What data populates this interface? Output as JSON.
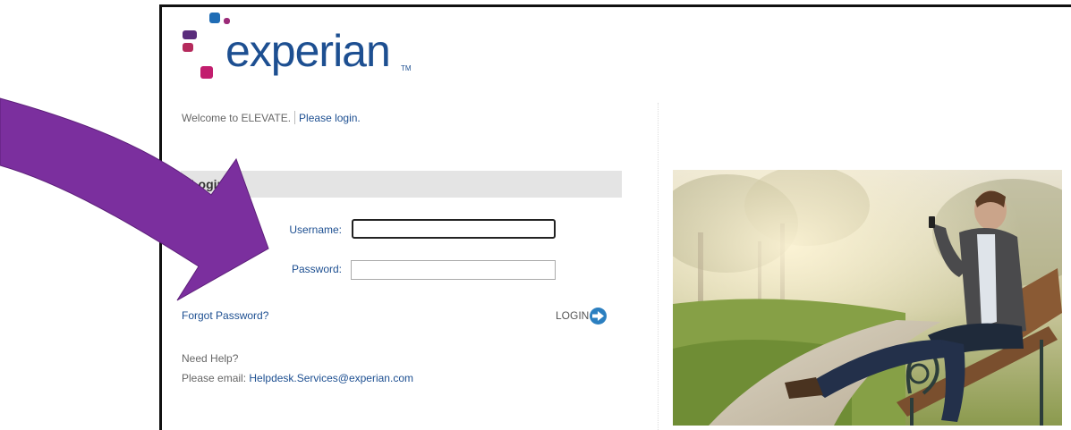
{
  "logo": {
    "text": "experian",
    "tm": "TM"
  },
  "welcome": {
    "text": "Welcome to ELEVATE.",
    "link": "Please login."
  },
  "login_section": {
    "header": "Login"
  },
  "form": {
    "username_label": "Username:",
    "password_label": "Password:",
    "username_value": "",
    "password_value": ""
  },
  "actions": {
    "forgot": "Forgot Password?",
    "login": "LOGIN"
  },
  "help": {
    "title": "Need Help?",
    "prefix": "Please email:",
    "email": "Helpdesk.Services@experian.com"
  },
  "colors": {
    "brand_blue": "#1d4f91",
    "arrow_purple": "#7b2f9e",
    "button_blue": "#2b7fc0"
  },
  "icons": [
    "arrow-pointer-icon",
    "login-arrow-icon"
  ]
}
